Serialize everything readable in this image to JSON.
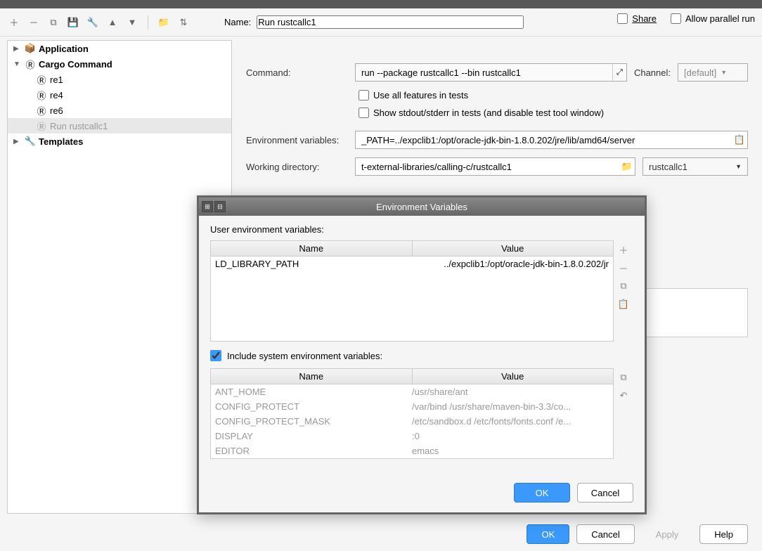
{
  "toolbar_name_label": "Name:",
  "name_value": "Run rustcallc1",
  "share_label": "Share",
  "parallel_label": "Allow parallel run",
  "sidebar": {
    "application": "Application",
    "cargo_command": "Cargo Command",
    "items": [
      "re1",
      "re4",
      "re6",
      "Run rustcallc1"
    ],
    "templates": "Templates"
  },
  "form": {
    "command_label": "Command:",
    "command_value": "run --package rustcallc1 --bin rustcallc1",
    "channel_label": "Channel:",
    "channel_value": "[default]",
    "use_all_features": "Use all features in tests",
    "show_stdout": "Show stdout/stderr in tests (and disable test tool window)",
    "env_label": "Environment variables:",
    "env_value": "_PATH=../expclib1:/opt/oracle-jdk-bin-1.8.0.202/jre/lib/amd64/server",
    "workdir_label": "Working directory:",
    "workdir_value": "t-external-libraries/calling-c/rustcallc1",
    "module_value": "rustcallc1"
  },
  "dialog": {
    "title": "Environment Variables",
    "user_env_label": "User environment variables:",
    "name_header": "Name",
    "value_header": "Value",
    "user_rows": [
      {
        "name": "LD_LIBRARY_PATH",
        "value": "../expclib1:/opt/oracle-jdk-bin-1.8.0.202/jr"
      }
    ],
    "include_label": "Include system environment variables:",
    "sys_rows": [
      {
        "name": "ANT_HOME",
        "value": "/usr/share/ant"
      },
      {
        "name": "CONFIG_PROTECT",
        "value": "/var/bind /usr/share/maven-bin-3.3/co..."
      },
      {
        "name": "CONFIG_PROTECT_MASK",
        "value": "/etc/sandbox.d /etc/fonts/fonts.conf /e..."
      },
      {
        "name": "DISPLAY",
        "value": ":0"
      },
      {
        "name": "EDITOR",
        "value": "emacs"
      }
    ],
    "ok": "OK",
    "cancel": "Cancel"
  },
  "buttons": {
    "ok": "OK",
    "cancel": "Cancel",
    "apply": "Apply",
    "help": "Help"
  }
}
